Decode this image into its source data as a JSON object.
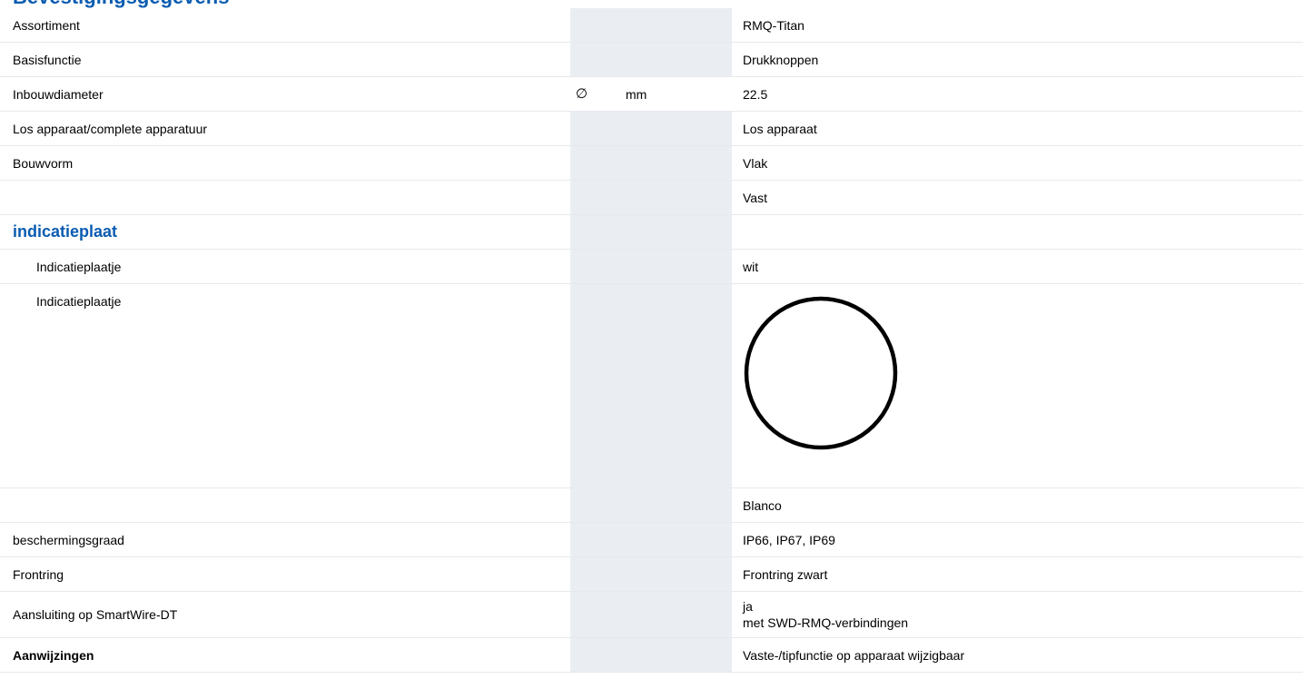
{
  "section": {
    "title": "Bevestigingsgegevens"
  },
  "rows": [
    {
      "label": "Assortiment",
      "symbol": "",
      "unit": "",
      "value": "RMQ-Titan"
    },
    {
      "label": "Basisfunctie",
      "symbol": "",
      "unit": "",
      "value": "Drukknoppen"
    },
    {
      "label": "Inbouwdiameter",
      "symbol": "∅",
      "unit": "mm",
      "value": "22.5"
    },
    {
      "label": "Los apparaat/complete apparatuur",
      "symbol": "",
      "unit": "",
      "value": "Los apparaat"
    },
    {
      "label": "Bouwvorm",
      "symbol": "",
      "unit": "",
      "value": "Vlak"
    },
    {
      "label": "",
      "symbol": "",
      "unit": "",
      "value": "Vast"
    }
  ],
  "subsection": {
    "title": "indicatieplaat",
    "rows": [
      {
        "label": "Indicatieplaatje",
        "value": "wit"
      },
      {
        "label": "Indicatieplaatje",
        "value": "",
        "image": "blank-circle-icon"
      },
      {
        "label": "",
        "value": "Blanco"
      }
    ]
  },
  "rows_after": [
    {
      "label": "beschermingsgraad",
      "value": "IP66, IP67, IP69"
    },
    {
      "label": "Frontring",
      "value": "Frontring zwart"
    },
    {
      "label": "Aansluiting op SmartWire-DT",
      "value_lines": [
        "ja",
        "met SWD-RMQ-verbindingen"
      ]
    },
    {
      "label": "Aanwijzingen",
      "value": "Vaste-/tipfunctie op apparaat wijzigbaar"
    }
  ],
  "colors": {
    "accent": "#0a5cb0",
    "shade": "#eaeef3",
    "divider": "#e6e9ec"
  }
}
